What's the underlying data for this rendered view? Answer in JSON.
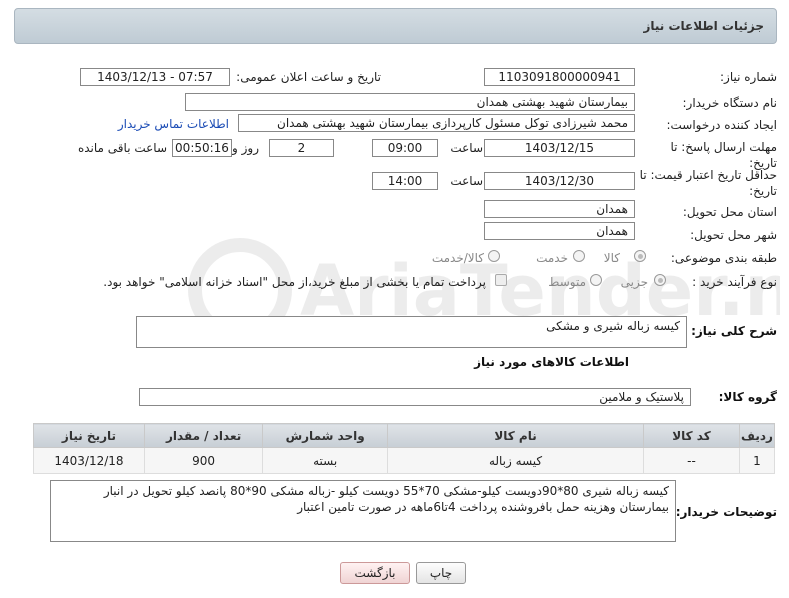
{
  "header": {
    "title": "جزئیات اطلاعات نیاز"
  },
  "fields": {
    "need_number_label": "شماره نیاز:",
    "need_number": "1103091800000941",
    "announce_label": "تاریخ و ساعت اعلان عمومی:",
    "announce_value": "1403/12/13 - 07:57",
    "buyer_label": "نام دستگاه خریدار:",
    "buyer_value": "بیمارستان شهید بهشتی همدان",
    "creator_label": "ایجاد کننده درخواست:",
    "creator_value": "محمد شیرزادی توکل مسئول کارپردازی بیمارستان شهید بهشتی همدان",
    "contact_link": "اطلاعات تماس خریدار",
    "deadline_label": "مهلت ارسال پاسخ: تا تاریخ:",
    "deadline_date": "1403/12/15",
    "time_label": "ساعت",
    "deadline_time": "09:00",
    "days_value": "2",
    "days_label": "روز و",
    "remaining_value": "00:50:16",
    "remaining_label": "ساعت باقی مانده",
    "validity_label": "حداقل تاریخ اعتبار قیمت: تا تاریخ:",
    "validity_date": "1403/12/30",
    "validity_time_label": "ساعت",
    "validity_time": "14:00",
    "province_label": "استان محل تحویل:",
    "province_value": "همدان",
    "city_label": "شهر محل تحویل:",
    "city_value": "همدان",
    "category_label": "طبقه بندی موضوعی:",
    "category_options": [
      "کالا",
      "خدمت",
      "کالا/خدمت"
    ],
    "process_label": "نوع فرآیند خرید :",
    "process_options": [
      "جزیی",
      "متوسط"
    ],
    "process_note": "پرداخت تمام یا بخشی از مبلغ خرید،از محل \"اسناد خزانه اسلامی\" خواهد بود."
  },
  "summary": {
    "label": "شرح کلی نیاز:",
    "value": "کیسه زباله شیری و مشکی"
  },
  "goods_section": {
    "title": "اطلاعات کالاهای مورد نیاز",
    "group_label": "گروه کالا:",
    "group_value": "پلاستیک و ملامین"
  },
  "table": {
    "headers": [
      "ردیف",
      "کد کالا",
      "نام کالا",
      "واحد شمارش",
      "تعداد / مقدار",
      "تاریخ نیاز"
    ],
    "rows": [
      [
        "1",
        "--",
        "کیسه زباله",
        "بسته",
        "900",
        "1403/12/18"
      ]
    ]
  },
  "buyer_notes": {
    "label": "توضیحات خریدار:",
    "value": "کیسه زباله شیری 80*90دویست کیلو-مشکی 70*55 دویست کیلو -زباله مشکی 90*80 پانصد کیلو تحویل در انبار بیمارستان وهزینه حمل بافروشنده پرداخت 4تا6ماهه در صورت تامین اعتبار"
  },
  "buttons": {
    "print": "چاپ",
    "back": "بازگشت"
  },
  "watermark": "AriaTender.net"
}
